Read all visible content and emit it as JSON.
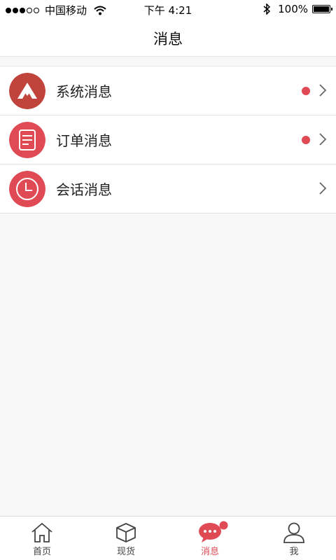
{
  "status_bar": {
    "signal_filled": 3,
    "signal_total": 5,
    "carrier": "中国移动",
    "time": "下午 4:21",
    "battery": "100%",
    "battery_level": 1.0
  },
  "header": {
    "title": "消息"
  },
  "messages": [
    {
      "label": "系统消息",
      "icon": "system-logo-icon",
      "icon_color": "#c0433c",
      "unread": true
    },
    {
      "label": "订单消息",
      "icon": "order-document-icon",
      "icon_color": "#e04a55",
      "unread": true
    },
    {
      "label": "会话消息",
      "icon": "clock-icon",
      "icon_color": "#e04a55",
      "unread": false
    }
  ],
  "tabs": [
    {
      "label": "首页",
      "icon": "home-icon",
      "active": false
    },
    {
      "label": "现货",
      "icon": "cube-icon",
      "active": false
    },
    {
      "label": "消息",
      "icon": "chat-bubble-icon",
      "active": true,
      "badge": true
    },
    {
      "label": "我",
      "icon": "person-icon",
      "active": false
    }
  ],
  "colors": {
    "accent": "#e04a55",
    "badge": "#e04a55"
  }
}
